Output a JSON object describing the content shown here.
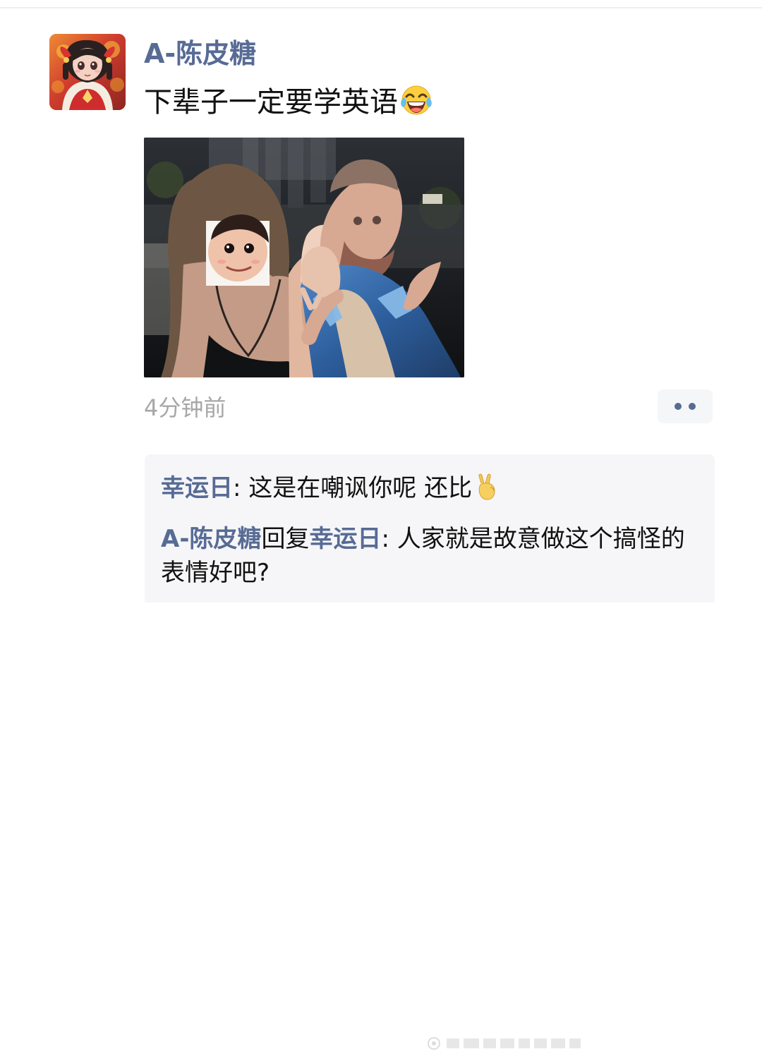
{
  "post": {
    "author": "A-陈皮糖",
    "text": "下辈子一定要学英语",
    "timestamp": "4分钟前",
    "avatar_icon": "anime-girl-avatar-icon",
    "image_icon": "photo-with-sticker-icon",
    "text_emoji": "laughing-with-tears-emoji"
  },
  "actions": {
    "more_icon": "more-dots-icon"
  },
  "comments": [
    {
      "name": "幸运日",
      "separator": ":",
      "text": " 这是在嘲讽你呢 还比",
      "emoji": "victory-hand-emoji"
    },
    {
      "name": "A-陈皮糖",
      "reply_word": "回复",
      "reply_to": "幸运日",
      "separator": ":",
      "text": " 人家就是故意做这个搞怪的表情好吧?"
    }
  ],
  "colors": {
    "link": "#576b95",
    "timestamp": "#a7a7a7",
    "comment_bg": "#f6f6f8",
    "text": "#111111"
  }
}
